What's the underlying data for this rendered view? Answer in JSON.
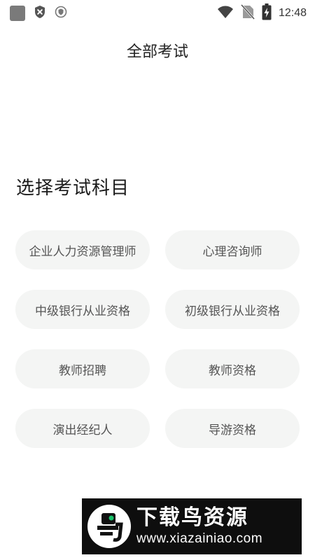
{
  "status_bar": {
    "time": "12:48",
    "icons": [
      "app-square-icon",
      "shield-x-icon",
      "shield-dot-icon",
      "wifi-icon",
      "no-sim-icon",
      "battery-charging-icon"
    ]
  },
  "header": {
    "title": "全部考试"
  },
  "section": {
    "title": "选择考试科目"
  },
  "subjects": [
    {
      "label": "企业人力资源管理师"
    },
    {
      "label": "心理咨询师"
    },
    {
      "label": "中级银行从业资格"
    },
    {
      "label": "初级银行从业资格"
    },
    {
      "label": "教师招聘"
    },
    {
      "label": "教师资格"
    },
    {
      "label": "演出经纪人"
    },
    {
      "label": "导游资格"
    }
  ],
  "watermark": {
    "brand": "下载鸟资源",
    "url": "www.xiazainiao.com"
  },
  "colors": {
    "pill_bg": "#f4f5f4",
    "pill_text": "#555555",
    "watermark_bg": "#0e0e0e"
  }
}
